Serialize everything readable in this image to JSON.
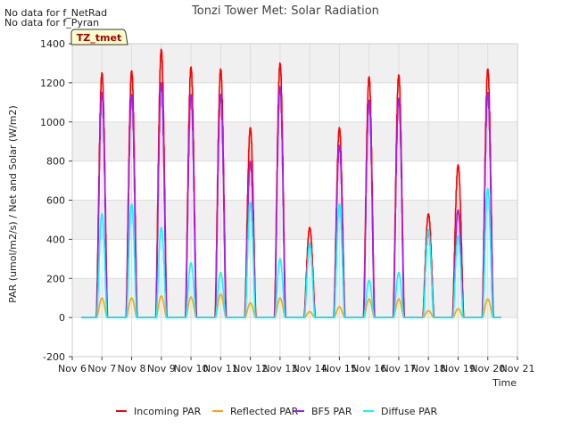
{
  "notes": [
    "No data for f_NetRad",
    "No data for f_Pyran"
  ],
  "site_tag": "TZ_tmet",
  "chart_data": {
    "type": "line",
    "title": "Tonzi Tower Met: Solar Radiation",
    "xlabel": "Time",
    "ylabel": "PAR (umol/m2/s) / Net and Solar (W/m2)",
    "xlim": [
      6,
      21
    ],
    "ylim": [
      -200,
      1400
    ],
    "x_ticks": [
      "Nov 6",
      "Nov 7",
      "Nov 8",
      "Nov 9",
      "Nov 10",
      "Nov 11",
      "Nov 12",
      "Nov 13",
      "Nov 14",
      "Nov 15",
      "Nov 16",
      "Nov 17",
      "Nov 18",
      "Nov 19",
      "Nov 20",
      "Nov 21"
    ],
    "y_ticks": [
      -200,
      0,
      200,
      400,
      600,
      800,
      1000,
      1200,
      1400
    ],
    "grid": true,
    "legend_position": "bottom",
    "x_unit_note": "x values are day of November 2023-style calendar (e.g. 9.5 = Nov 9, 12:00)",
    "days": [
      7,
      8,
      9,
      10,
      11,
      12,
      13,
      14,
      15,
      16,
      17,
      18,
      19,
      20
    ],
    "series": [
      {
        "name": "Incoming PAR",
        "color": "#ff0000",
        "daily_peaks": [
          1250,
          1260,
          1370,
          1280,
          1270,
          970,
          1300,
          460,
          970,
          1230,
          1240,
          530,
          780,
          1270
        ]
      },
      {
        "name": "Reflected PAR",
        "color": "#ffa500",
        "daily_peaks": [
          100,
          100,
          110,
          105,
          120,
          75,
          100,
          30,
          55,
          95,
          95,
          35,
          45,
          95
        ]
      },
      {
        "name": "BF5 PAR",
        "color": "#a020f0",
        "daily_peaks": [
          1150,
          1140,
          1200,
          1140,
          1140,
          800,
          1180,
          380,
          880,
          1110,
          1120,
          440,
          550,
          1150
        ]
      },
      {
        "name": "Diffuse PAR",
        "color": "#00ffff",
        "daily_peaks": [
          530,
          580,
          460,
          280,
          230,
          590,
          300,
          380,
          580,
          190,
          230,
          450,
          420,
          660
        ]
      }
    ]
  }
}
